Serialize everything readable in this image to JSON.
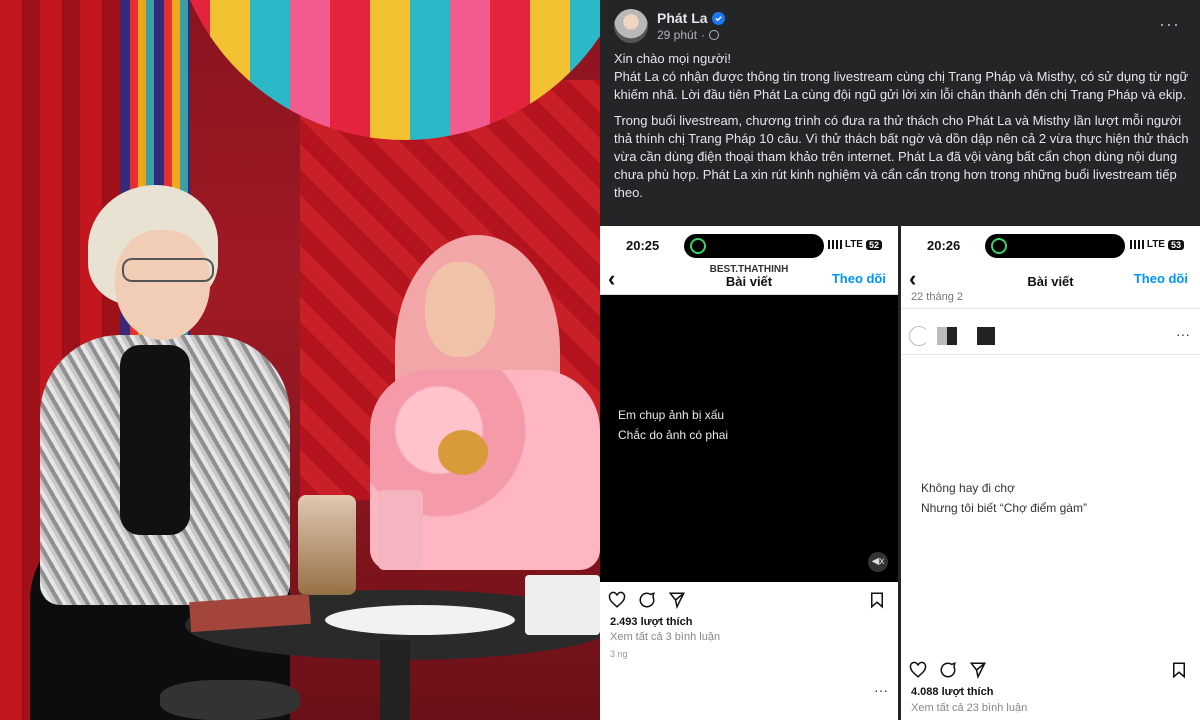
{
  "post": {
    "author": "Phát La",
    "time": "29 phút",
    "separator": "·",
    "paragraph1": "Xin chào mọi người!\nPhát La có nhận được thông tin trong livestream cùng chị Trang Pháp và Misthy, có sử dụng từ ngữ khiếm nhã. Lời đầu tiên Phát La cùng đội ngũ gửi lời xin lỗi chân thành đến chị Trang Pháp và ekip.",
    "paragraph2": "Trong buổi livestream, chương trình có đưa ra thử thách cho Phát La và Misthy lần lượt mỗi người thả thính chị Trang Pháp 10 câu. Vì thử thách bất ngờ và dồn dập nên cả 2 vừa thực hiện thử thách vừa cần dùng điện thoại tham khảo trên internet. Phát La đã vội vàng bất cẩn chọn dùng nội dung chưa phù hợp. Phát La xin rút kinh nghiệm và cẩn cẩn trọng hơn trong những buổi livestream tiếp theo.",
    "more": "···"
  },
  "shot1": {
    "time": "20:25",
    "network": "LTE",
    "battery": "52",
    "username": "BEST.THATHINH",
    "title": "Bài viết",
    "follow": "Theo dõi",
    "line1": "Em chụp ảnh bị xấu",
    "line2": "Chắc do ảnh có phai",
    "likes": "2.493 lượt thích",
    "comments": "Xem tất cả 3 bình luận",
    "ago": "3 ng",
    "dots": "···",
    "mute": "◀x"
  },
  "shot2": {
    "time": "20:26",
    "network": "LTE",
    "battery": "53",
    "title": "Bài viết",
    "follow": "Theo dõi",
    "date": "22 tháng 2",
    "dots": "···",
    "line1": "Không hay đi chợ",
    "line2": "Nhưng tôi biết “Chợ điểm gàm”",
    "likes": "4.088 lượt thích",
    "comments": "Xem tất cả 23 bình luận"
  },
  "colors": {
    "fb_bg": "#242526",
    "fb_text": "#e4e6eb",
    "verified": "#1877f2",
    "ig_follow": "#0095f6"
  }
}
